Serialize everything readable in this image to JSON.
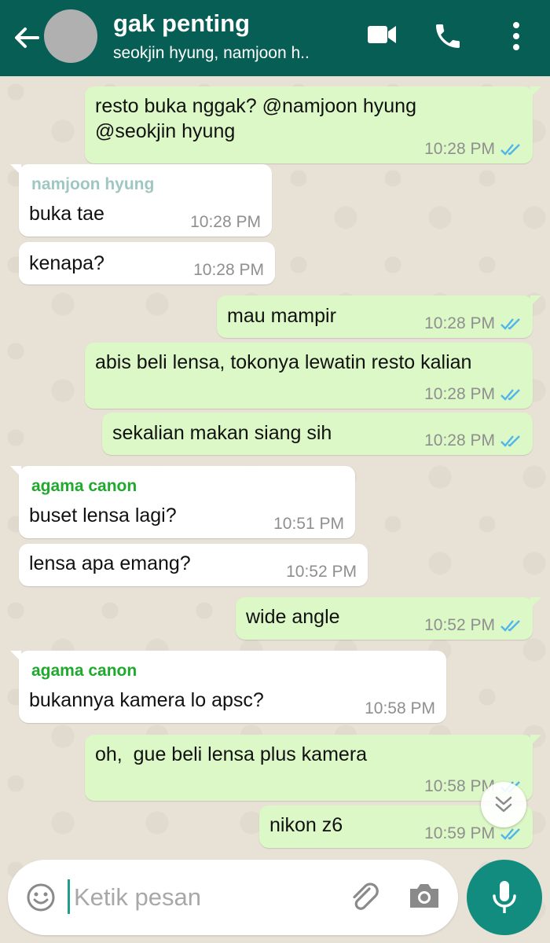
{
  "header": {
    "title": "gak penting",
    "subtitle": "seokjin hyung, namjoon h.."
  },
  "messages": [
    {
      "dir": "out",
      "lines": [
        "resto buka nggak? @namjoon hyung",
        "@seokjin hyung"
      ],
      "time": "10:28 PM",
      "status": "read"
    },
    {
      "dir": "in",
      "sender": "namjoon hyung",
      "sender_color": "#9fc7c2",
      "lines": [
        "buka tae"
      ],
      "time": "10:28 PM"
    },
    {
      "dir": "in",
      "lines": [
        "kenapa?"
      ],
      "time": "10:28 PM"
    },
    {
      "dir": "out",
      "lines": [
        "mau mampir"
      ],
      "time": "10:28 PM",
      "status": "read"
    },
    {
      "dir": "out",
      "lines": [
        "abis beli lensa, tokonya lewatin resto kalian"
      ],
      "time": "10:28 PM",
      "status": "read"
    },
    {
      "dir": "out",
      "lines": [
        "sekalian makan siang sih"
      ],
      "time": "10:28 PM",
      "status": "read"
    },
    {
      "dir": "in",
      "sender": "agama canon",
      "sender_color": "#1faa2e",
      "lines": [
        "buset lensa lagi?"
      ],
      "time": "10:51 PM"
    },
    {
      "dir": "in",
      "lines": [
        "lensa apa emang?"
      ],
      "time": "10:52 PM"
    },
    {
      "dir": "out",
      "lines": [
        "wide angle"
      ],
      "time": "10:52 PM",
      "status": "read"
    },
    {
      "dir": "in",
      "sender": "agama canon",
      "sender_color": "#1faa2e",
      "lines": [
        "bukannya kamera lo apsc?"
      ],
      "time": "10:58 PM"
    },
    {
      "dir": "out",
      "lines": [
        "oh,  gue beli lensa plus kamera"
      ],
      "time": "10:58 PM",
      "status": "read"
    },
    {
      "dir": "out",
      "lines": [
        "nikon z6"
      ],
      "time": "10:59 PM",
      "status": "read"
    }
  ],
  "composer": {
    "placeholder": "Ketik pesan"
  },
  "colors": {
    "header": "#075e54",
    "outgoing": "#dcf8c6",
    "incoming": "#ffffff",
    "read_ticks": "#4fb6ec",
    "fab": "#128c7e"
  },
  "icons": {
    "back": "arrow-left-icon",
    "video": "video-camera-icon",
    "call": "phone-icon",
    "menu": "more-vertical-icon",
    "emoji": "emoji-icon",
    "attach": "paperclip-icon",
    "camera": "camera-icon",
    "mic": "microphone-icon",
    "scroll": "double-chevron-down-icon"
  }
}
